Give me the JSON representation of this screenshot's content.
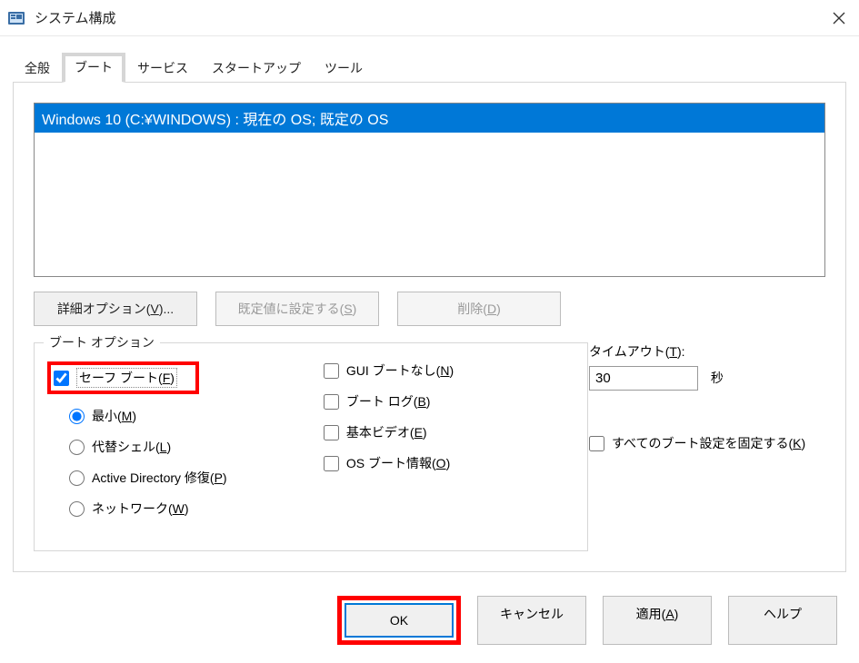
{
  "window": {
    "title": "システム構成"
  },
  "tabs": {
    "general": "全般",
    "boot": "ブート",
    "services": "サービス",
    "startup": "スタートアップ",
    "tools": "ツール"
  },
  "list": {
    "item0": "Windows 10 (C:¥WINDOWS) : 現在の OS; 既定の OS"
  },
  "buttons": {
    "advanced": "詳細オプション(V)...",
    "setdefault": "既定値に設定する(S)",
    "delete": "削除(D)"
  },
  "groupbox": {
    "boot_options": "ブート オプション"
  },
  "safe": {
    "label_pre": "セーフ ブート(",
    "label_key": "F",
    "label_post": ")",
    "min_pre": "最小(",
    "min_key": "M",
    "min_post": ")",
    "alt_pre": "代替シェル(",
    "alt_key": "L",
    "alt_post": ")",
    "ad_pre": "Active Directory 修復(",
    "ad_key": "P",
    "ad_post": ")",
    "net_pre": "ネットワーク(",
    "net_key": "W",
    "net_post": ")"
  },
  "chk": {
    "nogui_pre": "GUI ブートなし(",
    "nogui_key": "N",
    "nogui_post": ")",
    "bootlog_pre": "ブート ログ(",
    "bootlog_key": "B",
    "bootlog_post": ")",
    "basevid_pre": "基本ビデオ(",
    "basevid_key": "E",
    "basevid_post": ")",
    "bootinfo_pre": "OS ブート情報(",
    "bootinfo_key": "O",
    "bootinfo_post": ")"
  },
  "timeout": {
    "label_pre": "タイムアウト(",
    "label_key": "T",
    "label_post": "):",
    "value": "30",
    "unit": "秒"
  },
  "fix": {
    "pre": "すべてのブート設定を固定する(",
    "key": "K",
    "post": ")"
  },
  "dlg": {
    "ok": "OK",
    "cancel": "キャンセル",
    "apply_pre": "適用(",
    "apply_key": "A",
    "apply_post": ")",
    "help": "ヘルプ"
  }
}
